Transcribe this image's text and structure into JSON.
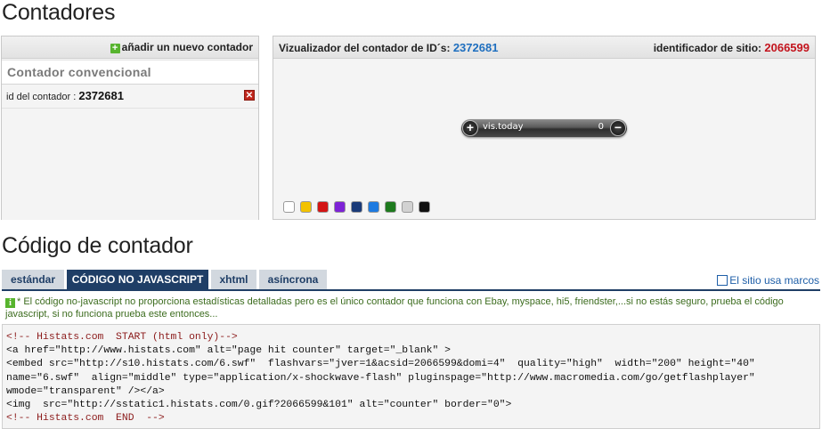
{
  "page_title": "Contadores",
  "left_panel": {
    "add_label": "añadir un nuevo contador",
    "section_title": "Contador convencional",
    "counter_row_label": "id del contador : ",
    "counter_row_id": "2372681"
  },
  "right_panel": {
    "viewer_label": "Vizualizador del contador de ID´s: ",
    "viewer_id": "2372681",
    "site_label": "identificador de sitio: ",
    "site_id": "2066599",
    "widget_label": "vis.today",
    "widget_value": "0",
    "swatches": [
      "#ffffff",
      "#f2c200",
      "#d31414",
      "#7d22d6",
      "#1a3a78",
      "#1d7ae0",
      "#1d7a1d",
      "#d2d2d2",
      "#111111"
    ]
  },
  "section_title": "Código de contador",
  "tabs": [
    {
      "label": "estándar"
    },
    {
      "label": "CÓDIGO NO JAVASCRIPT"
    },
    {
      "label": "xhtml"
    },
    {
      "label": "asíncrona"
    }
  ],
  "marcos_label": "El sitio usa marcos",
  "info_text": "* El código no-javascript no proporciona estadísticas detalladas pero es el único contador que funciona con Ebay, myspace, hi5, friendster,...si no estás seguro, prueba el código javascript, si no funciona prueba este entonces...",
  "code_lines": [
    "<!-- Histats.com  START (html only)-->",
    "<a href=\"http://www.histats.com\" alt=\"page hit counter\" target=\"_blank\" >",
    "<embed src=\"http://s10.histats.com/6.swf\"  flashvars=\"jver=1&acsid=2066599&domi=4\"  quality=\"high\"  width=\"200\" height=\"40\"",
    "name=\"6.swf\"  align=\"middle\" type=\"application/x-shockwave-flash\" pluginspage=\"http://www.macromedia.com/go/getflashplayer\"",
    "wmode=\"transparent\" /></a>",
    "<img  src=\"http://sstatic1.histats.com/0.gif?2066599&101\" alt=\"counter\" border=\"0\">",
    "<!-- Histats.com  END  -->"
  ],
  "colors": {
    "accent_navy": "#1f3e66",
    "blue_id": "#1f6fbf",
    "red_id": "#c3141d",
    "add_green": "#57b42e",
    "delete_red": "#c0261c"
  },
  "icons": [
    "plus-icon",
    "delete-icon",
    "widget-plus-icon",
    "widget-minus-icon",
    "info-icon",
    "checkbox"
  ]
}
